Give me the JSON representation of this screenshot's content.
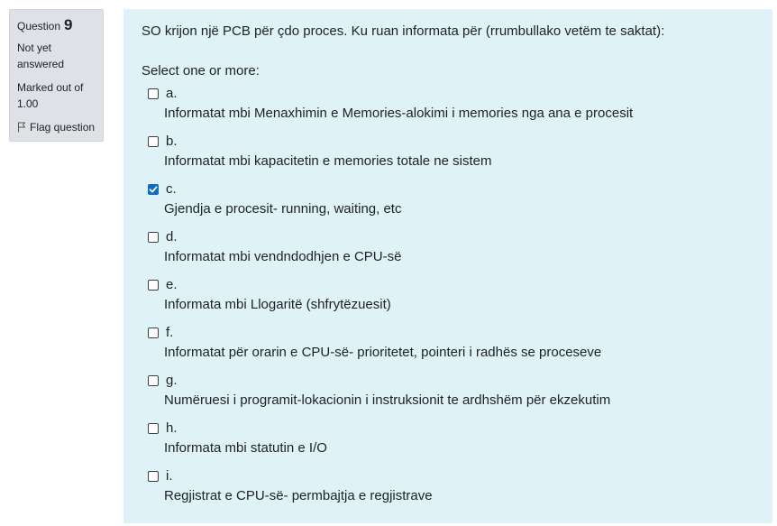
{
  "question_info": {
    "label": "Question",
    "number": "9",
    "state": "Not yet answered",
    "grade": "Marked out of 1.00",
    "flag_label": "Flag question"
  },
  "question": {
    "text": "SO krijon një PCB për çdo proces. Ku ruan informata për (rrumbullako vetëm te saktat):",
    "prompt": "Select one or more:",
    "options": [
      {
        "letter": "a.",
        "text": "Informatat mbi Menaxhimin e Memories-alokimi i memories nga ana e procesit",
        "checked": false
      },
      {
        "letter": "b.",
        "text": "Informatat mbi kapacitetin e memories totale ne sistem",
        "checked": false
      },
      {
        "letter": "c.",
        "text": "Gjendja e procesit- running, waiting, etc",
        "checked": true
      },
      {
        "letter": "d.",
        "text": "Informatat mbi vendndodhjen e CPU-së",
        "checked": false
      },
      {
        "letter": "e.",
        "text": "Informata mbi Llogaritë (shfrytëzuesit)",
        "checked": false
      },
      {
        "letter": "f.",
        "text": "Informatat për orarin e CPU-së- prioritetet, pointeri i radhës se proceseve",
        "checked": false
      },
      {
        "letter": "g.",
        "text": "Numëruesi i programit-lokacionin i instruksionit te ardhshëm për ekzekutim",
        "checked": false
      },
      {
        "letter": "h.",
        "text": "Informata mbi statutin e I/O",
        "checked": false
      },
      {
        "letter": "i.",
        "text": "Regjistrat e CPU-së- permbajtja e regjistrave",
        "checked": false
      }
    ]
  },
  "colors": {
    "info_bg": "#dee2e6",
    "formulation_bg": "#def2f8",
    "checkbox_checked": "#0f6cbf"
  }
}
